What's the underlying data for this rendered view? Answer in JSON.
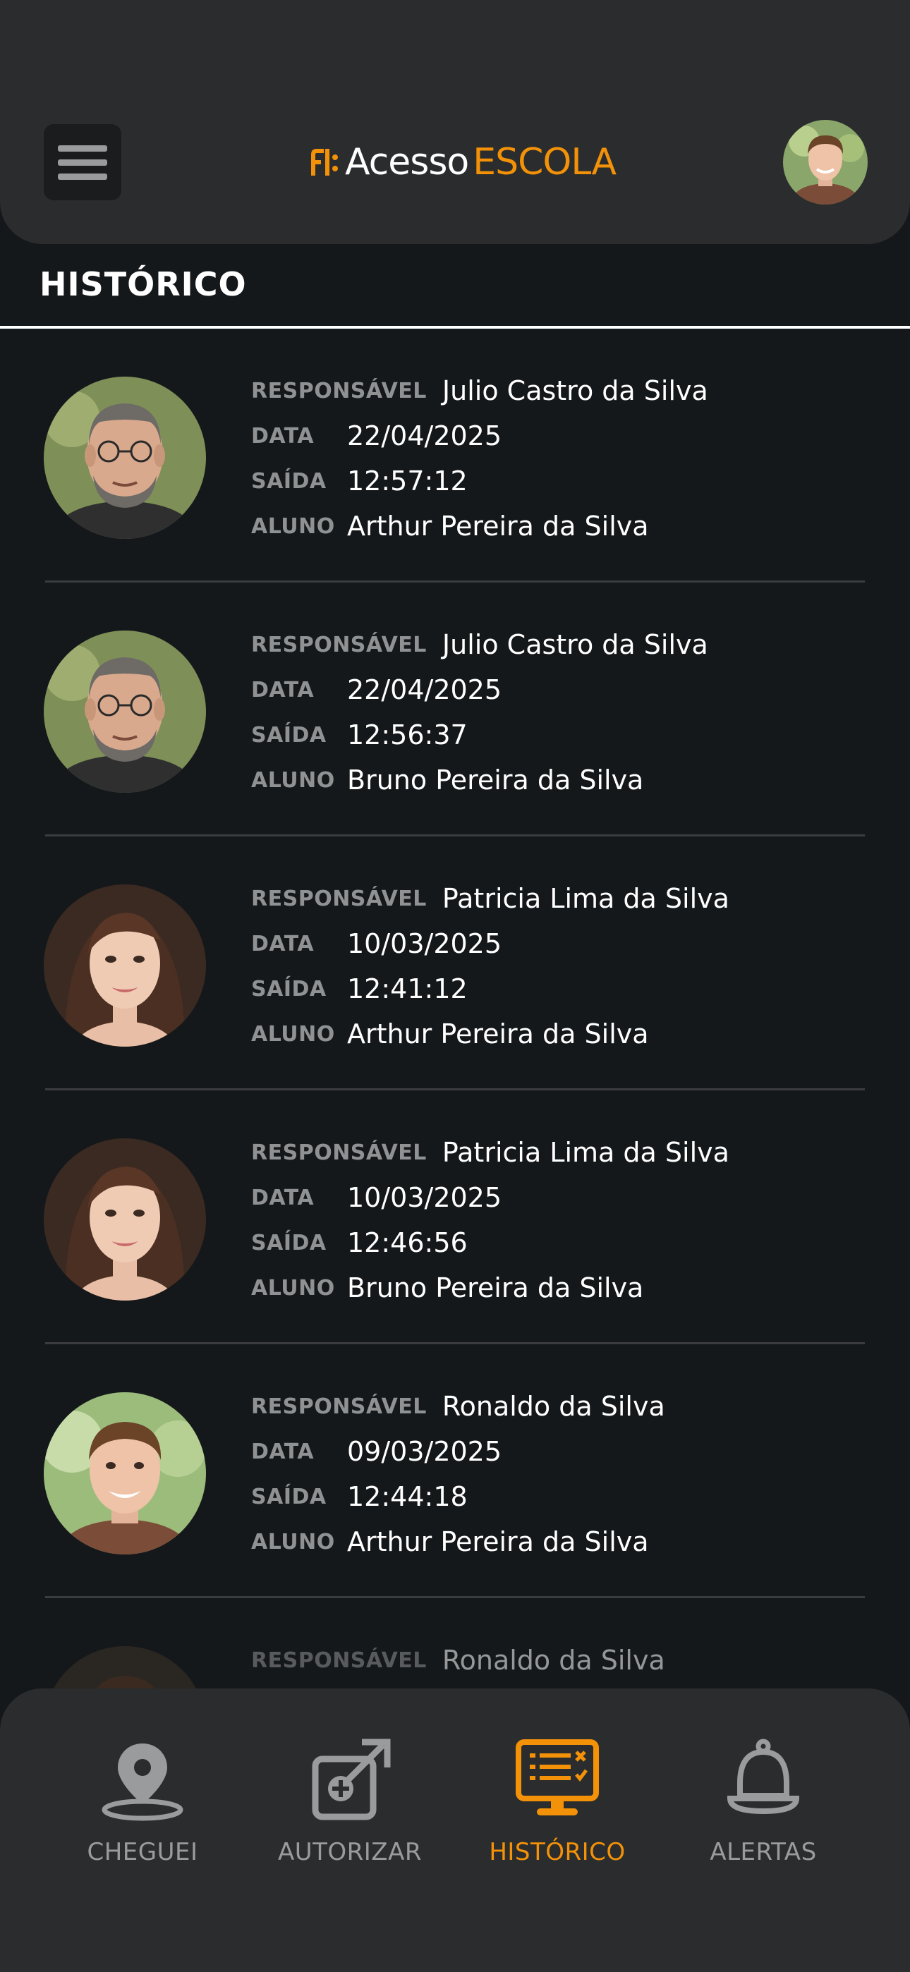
{
  "brand": {
    "name_a": "Acesso",
    "name_b": "ESCOLA",
    "accent": "#f39208"
  },
  "header": {
    "menu_icon": "hamburger-icon",
    "profile_avatar": "user-avatar"
  },
  "page": {
    "title": "HISTÓRICO"
  },
  "labels": {
    "responsavel": "RESPONSÁVEL",
    "data": "DATA",
    "saida": "SAÍDA",
    "aluno": "ALUNO"
  },
  "history": [
    {
      "responsavel": "Julio Castro da Silva",
      "data": "22/04/2025",
      "saida": "12:57:12",
      "aluno": "Arthur Pereira da Silva"
    },
    {
      "responsavel": "Julio Castro da Silva",
      "data": "22/04/2025",
      "saida": "12:56:37",
      "aluno": "Bruno Pereira da Silva"
    },
    {
      "responsavel": "Patricia Lima da Silva",
      "data": "10/03/2025",
      "saida": "12:41:12",
      "aluno": "Arthur Pereira da Silva"
    },
    {
      "responsavel": "Patricia Lima da Silva",
      "data": "10/03/2025",
      "saida": "12:46:56",
      "aluno": "Bruno Pereira da Silva"
    },
    {
      "responsavel": "Ronaldo da Silva",
      "data": "09/03/2025",
      "saida": "12:44:18",
      "aluno": "Arthur Pereira da Silva"
    },
    {
      "responsavel": "Ronaldo da Silva"
    }
  ],
  "nav": {
    "items": [
      {
        "label": "CHEGUEI",
        "icon": "location-pin-icon"
      },
      {
        "label": "AUTORIZAR",
        "icon": "authorize-arrow-icon"
      },
      {
        "label": "HISTÓRICO",
        "icon": "history-monitor-icon",
        "active": true
      },
      {
        "label": "ALERTAS",
        "icon": "bell-icon"
      }
    ]
  }
}
